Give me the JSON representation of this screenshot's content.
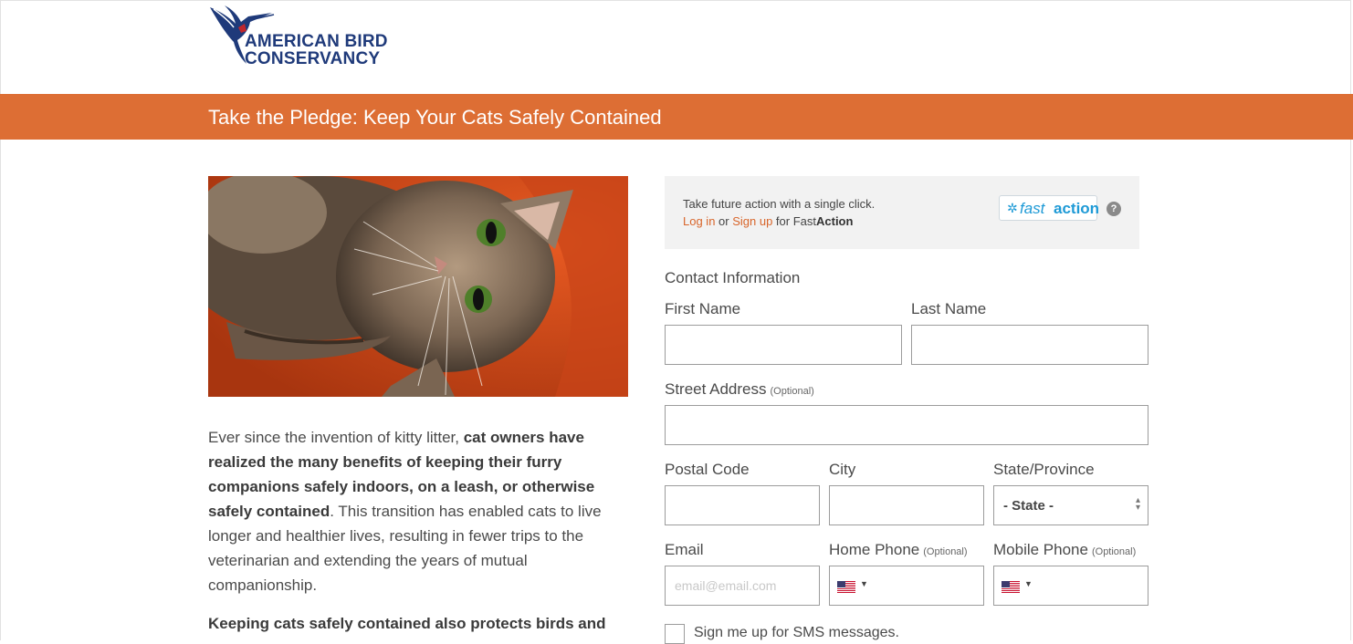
{
  "header": {
    "logo_line1": "AMERICAN BIRD",
    "logo_line2": "CONSERVANCY"
  },
  "banner": {
    "title": "Take the Pledge: Keep Your Cats Safely Contained"
  },
  "article": {
    "intro_before_bold": "Ever since the invention of kitty litter, ",
    "intro_bold": "cat owners have realized the many benefits of keeping their furry companions safely indoors, on a leash, or otherwise safely contained",
    "intro_after_bold": ". This transition has enabled cats to live longer and healthier lives, resulting in fewer trips to the veterinarian and extending the years of mutual companionship.",
    "second_paragraph": "Keeping cats safely contained also protects birds and"
  },
  "fastaction": {
    "line1": "Take future action with a single click.",
    "login": "Log in",
    "or": " or ",
    "signup": "Sign up",
    "for": " for Fast",
    "brand": "Action",
    "logo_fast": "fast",
    "logo_action": "action",
    "help": "?"
  },
  "form": {
    "section_title": "Contact Information",
    "first_name_label": "First Name",
    "last_name_label": "Last Name",
    "street_label": "Street Address",
    "optional": "(Optional)",
    "postal_label": "Postal Code",
    "city_label": "City",
    "state_label": "State/Province",
    "state_value": "- State -",
    "email_label": "Email",
    "email_placeholder": "email@email.com",
    "home_phone_label": "Home Phone",
    "mobile_phone_label": "Mobile Phone",
    "sms_label": "Sign me up for SMS messages."
  },
  "colors": {
    "banner": "#dd6e34",
    "link": "#d8652a",
    "logo_blue": "#1f3a7a",
    "fastaction_blue": "#1e9ad6"
  }
}
